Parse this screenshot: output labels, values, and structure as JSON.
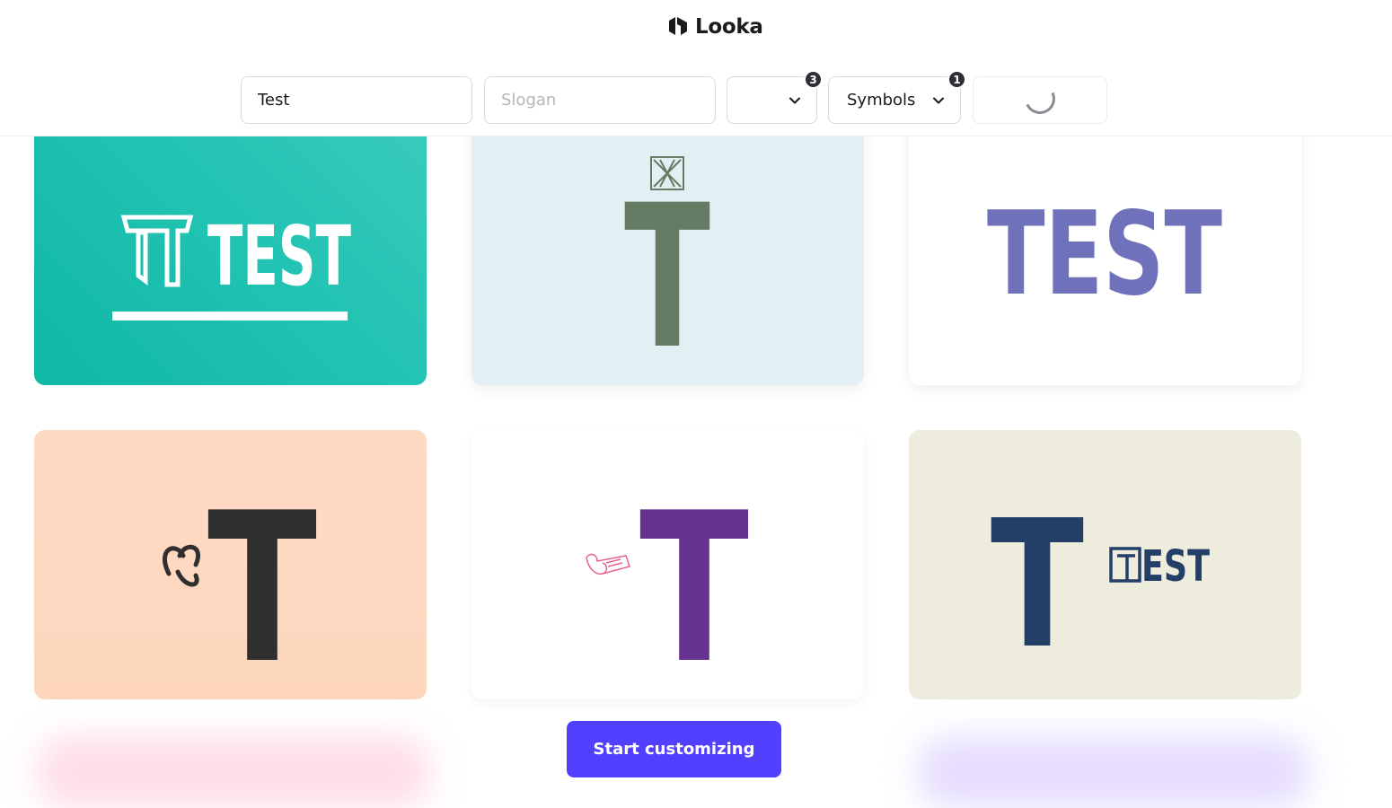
{
  "brand": {
    "name": "Looka",
    "logo_icon": "looka-logo-icon"
  },
  "search": {
    "company_name": "Test",
    "slogan_placeholder": "Slogan",
    "industry_count": "3",
    "symbols_label": "Symbols",
    "symbols_count": "1"
  },
  "logos": [
    {
      "text": "TEST",
      "background": "#1bbcab",
      "text_color": "#ffffff"
    },
    {
      "text": "T",
      "background": "#e2f0f4",
      "text_color": "#667b63"
    },
    {
      "text": "TEST",
      "background": "#ffffff",
      "text_color": "#6f72ba"
    },
    {
      "text": "T",
      "background": "#fed9c4",
      "text_color": "#2f2f2f"
    },
    {
      "text": "T",
      "background": "#ffffff",
      "text_color": "#65328f"
    },
    {
      "text": "T",
      "text_secondary": "EST",
      "background": "#edecdd",
      "text_color": "#233f67"
    }
  ],
  "cta": {
    "label": "Start customizing",
    "color": "#5141ff"
  }
}
